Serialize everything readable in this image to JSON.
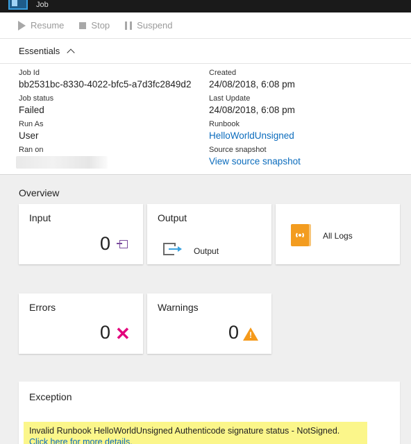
{
  "window": {
    "title": "Job"
  },
  "toolbar": {
    "resume": "Resume",
    "stop": "Stop",
    "suspend": "Suspend"
  },
  "essentials": {
    "label": "Essentials"
  },
  "props": {
    "job_id_label": "Job Id",
    "job_id": "bb2531bc-8330-4022-bfc5-a7d3fc2849d2",
    "job_status_label": "Job status",
    "job_status": "Failed",
    "run_as_label": "Run As",
    "run_as": "User",
    "ran_on_label": "Ran on",
    "created_label": "Created",
    "created": "24/08/2018, 6:08 pm",
    "last_update_label": "Last Update",
    "last_update": "24/08/2018, 6:08 pm",
    "runbook_label": "Runbook",
    "runbook": "HelloWorldUnsigned",
    "snapshot_label": "Source snapshot",
    "snapshot_link": "View source snapshot"
  },
  "overview": {
    "title": "Overview",
    "input": {
      "label": "Input",
      "count": "0"
    },
    "output": {
      "label": "Output",
      "link": "Output"
    },
    "logs": {
      "label": "All Logs"
    },
    "errors": {
      "label": "Errors",
      "count": "0"
    },
    "warnings": {
      "label": "Warnings",
      "count": "0"
    }
  },
  "exception": {
    "title": "Exception",
    "message": "Invalid Runbook HelloWorldUnsigned Authenticode signature status - NotSigned.",
    "link": "Click here for more details."
  },
  "colors": {
    "accent": "#0b6cbd",
    "error": "#e3007c",
    "warning": "#f59a1b",
    "logs": "#f39c1f",
    "highlight": "#fbf68a"
  }
}
